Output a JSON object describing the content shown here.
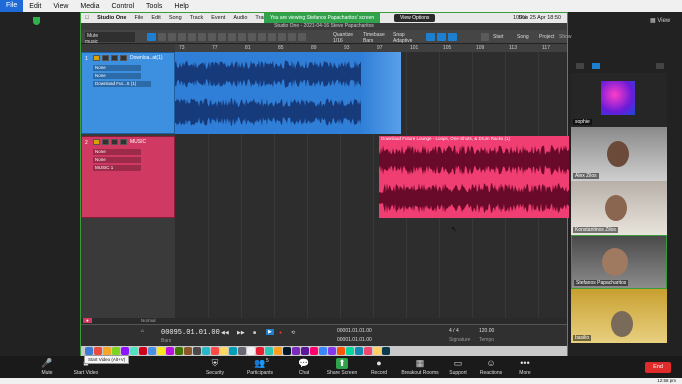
{
  "outer_menu": [
    "File",
    "Edit",
    "View",
    "Media",
    "Control",
    "Tools",
    "Help"
  ],
  "mac_menu": [
    "Studio One",
    "File",
    "Edit",
    "Song",
    "Track",
    "Event",
    "Audio",
    "Transport"
  ],
  "banner": "You are viewing Stefanos Papacharitos' screen",
  "view_options": "View Options",
  "mac_clock": "Sun 25 Apr  18:50",
  "mac_battery": "100%",
  "so_title": "Studio One - 2021-04-16 Steve Papacharitos",
  "toolbar": {
    "mute": "Mute",
    "music": "music",
    "quantize": "Quantize",
    "quantize_val": "1/16",
    "timebase": "Timebase",
    "timebase_val": "Bars",
    "snap": "Snap",
    "snap_val": "Adaptive",
    "start": "Start",
    "song": "Song",
    "project": "Project",
    "show": "Show"
  },
  "ruler_marks": [
    "73",
    "77",
    "81",
    "85",
    "89",
    "93",
    "97",
    "101",
    "105",
    "109",
    "113",
    "117"
  ],
  "tracks": [
    {
      "num": "1",
      "name": "Downloa..at(1)",
      "f1": "None",
      "f2": "None",
      "f3": "Download Fut...S (1)"
    },
    {
      "num": "2",
      "name": "MUSIC",
      "f1": "None",
      "f2": "None",
      "f3": "MUSIC 1"
    }
  ],
  "clip2_title": "Download Future Lounge - Loops, One-Shots, & Drum Racks (1)",
  "transport": {
    "tab": "Normal",
    "time": "00095.01.01.00",
    "pos1": "00001.01.01.00",
    "pos2": "00001.01.01.00",
    "sig": "4 / 4",
    "bpm": "120.00",
    "label_time": "Bars",
    "label_sig": "Signature",
    "label_tempo": "Tempo"
  },
  "participants": [
    {
      "name": "sophie"
    },
    {
      "name": "Alex Zilos"
    },
    {
      "name": "Konstantinos Zilos"
    },
    {
      "name": "Stefanos Papacharitos"
    },
    {
      "name": "basilio"
    }
  ],
  "view_label": "View",
  "zoom_controls": [
    {
      "label": "Mute",
      "icon": "🎤"
    },
    {
      "label": "Start Video",
      "icon": "■"
    },
    {
      "label": "Security",
      "icon": "🛡"
    },
    {
      "label": "Participants",
      "icon": "👥",
      "count": "5"
    },
    {
      "label": "Chat",
      "icon": "💬"
    },
    {
      "label": "Share Screen",
      "icon": "⬆"
    },
    {
      "label": "Record",
      "icon": "●"
    },
    {
      "label": "Breakout Rooms",
      "icon": "▦"
    },
    {
      "label": "Support",
      "icon": "▭"
    },
    {
      "label": "Reactions",
      "icon": "☺"
    },
    {
      "label": "More",
      "icon": "•••"
    }
  ],
  "end_label": "End",
  "tooltip": "Start Video (Alt+V)",
  "taskbar_time": "12:58 pm"
}
